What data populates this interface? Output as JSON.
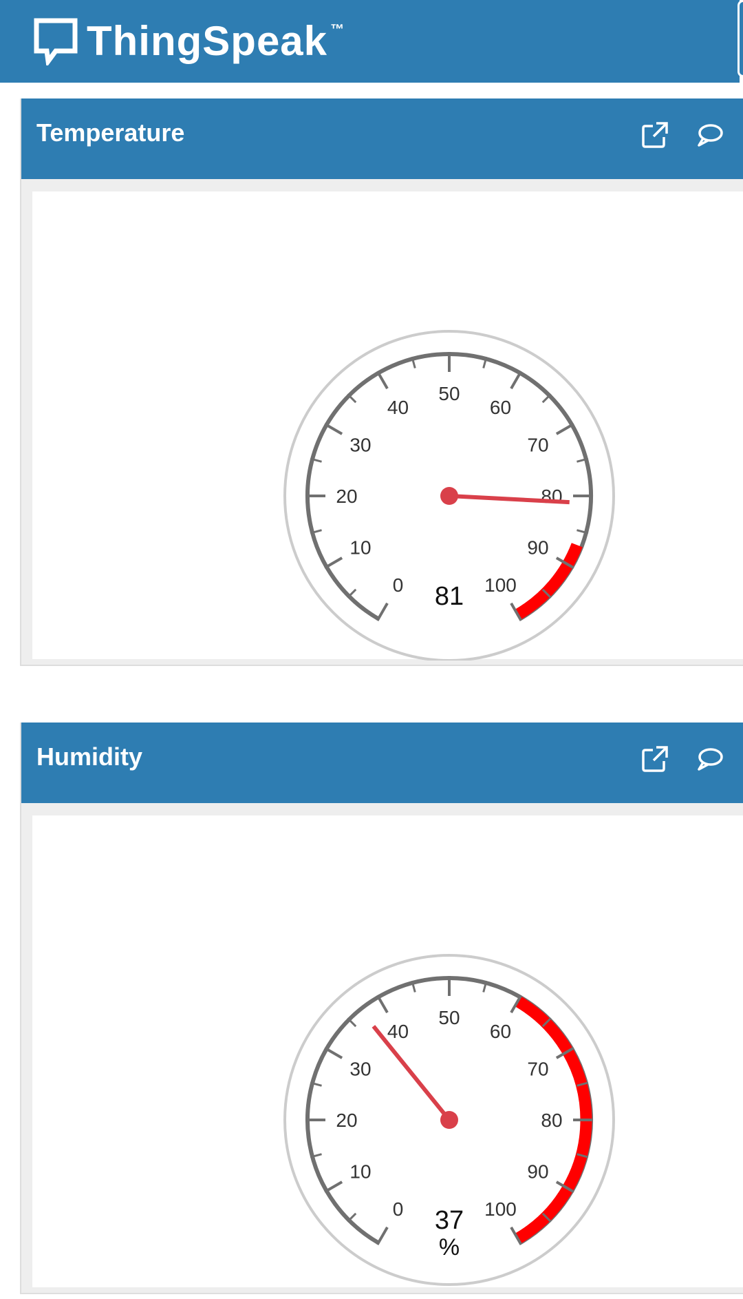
{
  "app": {
    "logo_text": "ThingSpeak",
    "trademark": "™",
    "brand_color": "#2e7db2"
  },
  "widgets": [
    {
      "title": "Temperature",
      "icons": [
        "external-link-icon",
        "comment-icon"
      ],
      "gauge": {
        "min": 0,
        "max": 100,
        "value": 81,
        "value_label": "81",
        "units": "",
        "tick_labels": [
          "0",
          "10",
          "20",
          "30",
          "40",
          "50",
          "60",
          "70",
          "80",
          "90",
          "100"
        ],
        "red_band": [
          87,
          100
        ],
        "band_color": "#ff0000",
        "needle_color": "#d9404a"
      }
    },
    {
      "title": "Humidity",
      "icons": [
        "external-link-icon",
        "comment-icon"
      ],
      "gauge": {
        "min": 0,
        "max": 100,
        "value": 37,
        "value_label": "37",
        "units": "%",
        "tick_labels": [
          "0",
          "10",
          "20",
          "30",
          "40",
          "50",
          "60",
          "70",
          "80",
          "90",
          "100"
        ],
        "red_band": [
          60,
          100
        ],
        "band_color": "#ff0000",
        "needle_color": "#d9404a"
      }
    }
  ]
}
